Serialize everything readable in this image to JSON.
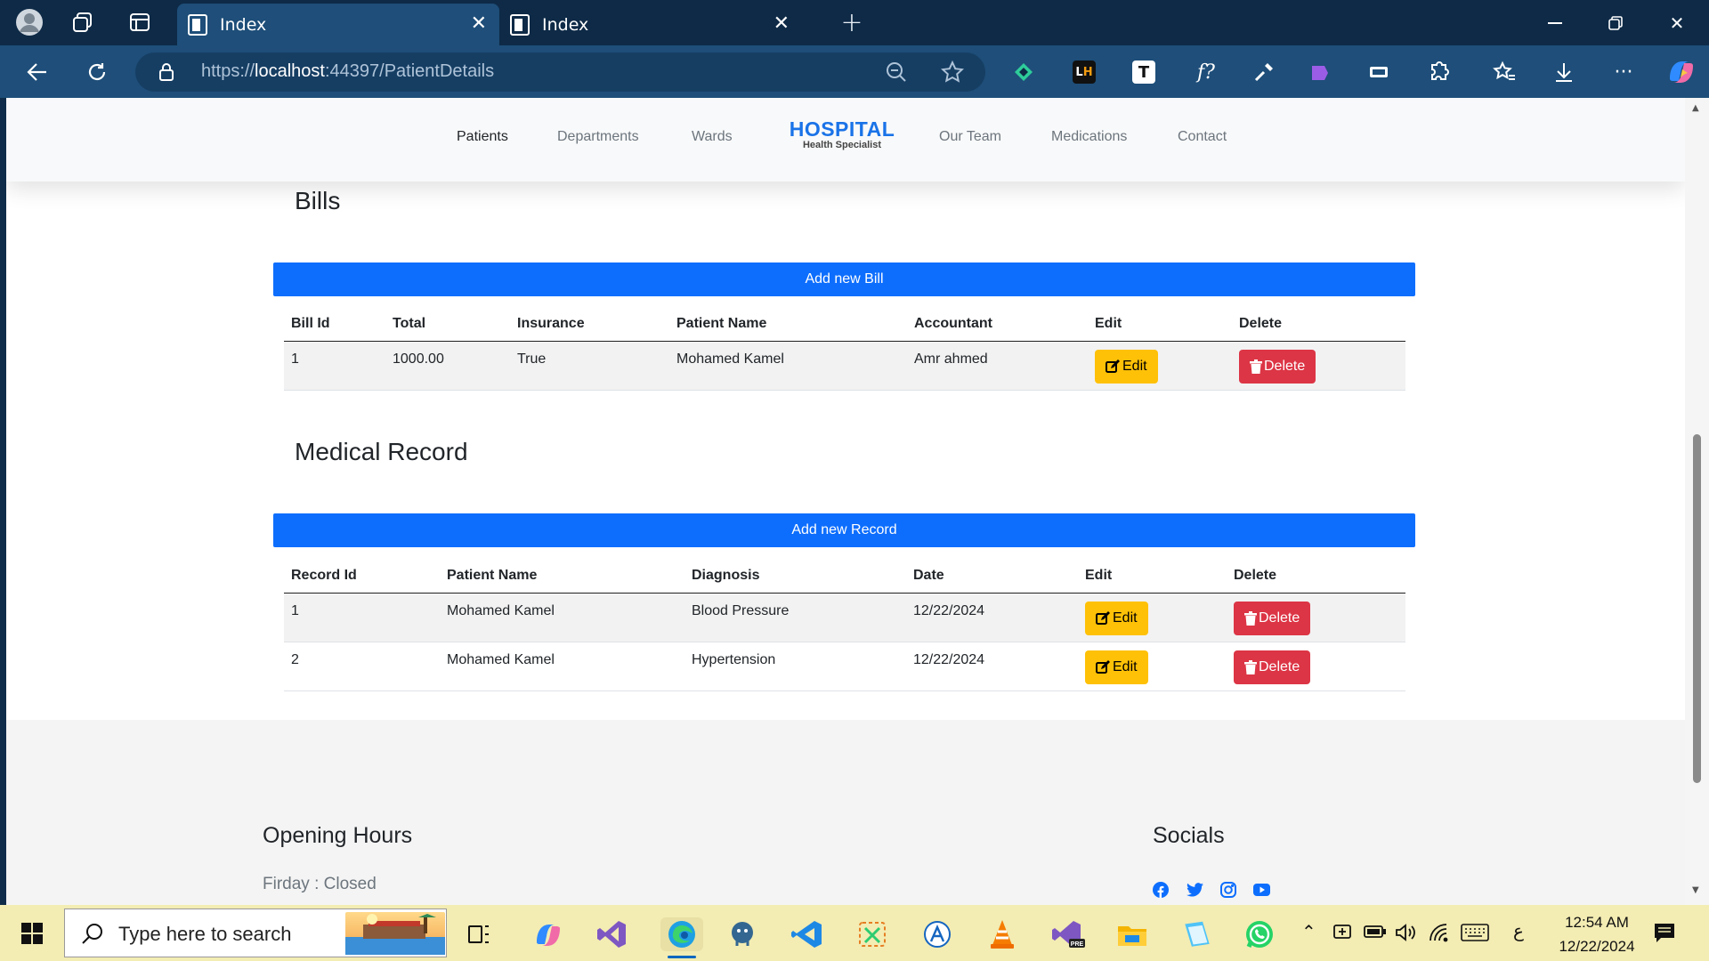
{
  "browser": {
    "tabs": [
      {
        "title": "Index",
        "active": true
      },
      {
        "title": "Index",
        "active": false
      }
    ],
    "url": {
      "scheme": "https://",
      "host": "localhost",
      "rest": ":44397/PatientDetails"
    }
  },
  "site": {
    "brand_title": "HOSPITAL",
    "brand_subtitle": "Health Specialist",
    "menu": [
      "Patients",
      "Departments",
      "Wards",
      "Our Team",
      "Medications",
      "Contact"
    ],
    "active_menu": "Patients"
  },
  "bills": {
    "heading": "Bills",
    "add_label": "Add new Bill",
    "columns": [
      "Bill Id",
      "Total",
      "Insurance",
      "Patient Name",
      "Accountant",
      "Edit",
      "Delete"
    ],
    "rows": [
      {
        "id": "1",
        "total": "1000.00",
        "insurance": "True",
        "patient": "Mohamed Kamel",
        "accountant": "Amr ahmed"
      }
    ],
    "edit_label": "Edit",
    "delete_label": "Delete"
  },
  "records": {
    "heading": "Medical Record",
    "add_label": "Add new Record",
    "columns": [
      "Record Id",
      "Patient Name",
      "Diagnosis",
      "Date",
      "Edit",
      "Delete"
    ],
    "rows": [
      {
        "id": "1",
        "patient": "Mohamed Kamel",
        "diagnosis": "Blood Pressure",
        "date": "12/22/2024"
      },
      {
        "id": "2",
        "patient": "Mohamed Kamel",
        "diagnosis": "Hypertension",
        "date": "12/22/2024"
      }
    ],
    "edit_label": "Edit",
    "delete_label": "Delete"
  },
  "footer": {
    "hours_heading": "Opening Hours",
    "hours_line": "Firday : Closed",
    "socials_heading": "Socials",
    "social_icons": [
      "facebook-icon",
      "twitter-icon",
      "instagram-icon",
      "youtube-icon"
    ]
  },
  "taskbar": {
    "search_placeholder": "Type here to search",
    "time": "12:54 AM",
    "date": "12/22/2024",
    "lang": "ع"
  },
  "colors": {
    "primary": "#0d6efd",
    "warning": "#ffc107",
    "danger": "#dc3545",
    "brand": "#1a73e8",
    "browser_frame": "#0e2a47",
    "taskbar": "#f3ecb3"
  }
}
